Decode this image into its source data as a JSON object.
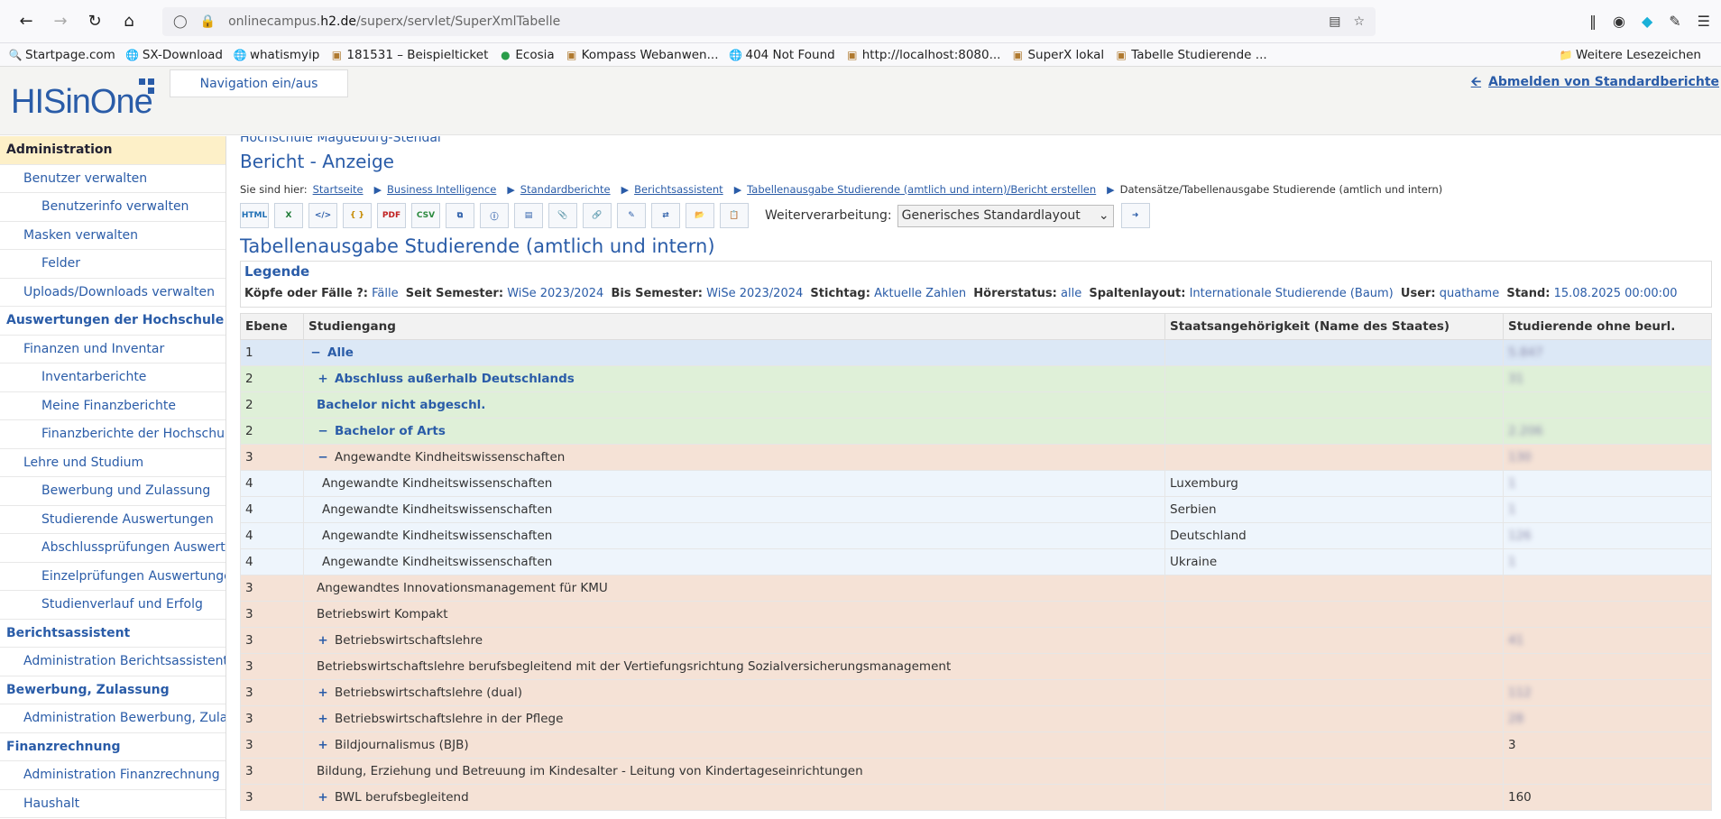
{
  "browser": {
    "url_prefix": "onlinecampus.",
    "url_domain": "h2.de",
    "url_path": "/superx/servlet/SuperXmlTabelle",
    "bookmarks": [
      "Startpage.com",
      "SX-Download",
      "whatismyip",
      "181531 – Beispielticket",
      "Ecosia",
      "Kompass Webanwen...",
      "404 Not Found",
      "http://localhost:8080...",
      "SuperX lokal",
      "Tabelle Studierende ..."
    ],
    "bookmarks_other": "Weitere Lesezeichen"
  },
  "header": {
    "logo": "HISinOne",
    "nav_toggle": "Navigation ein/aus",
    "logout": "Abmelden von Standardberichte"
  },
  "sidebar": [
    {
      "label": "Administration",
      "level": 0,
      "active": true
    },
    {
      "label": "Benutzer verwalten",
      "level": 1
    },
    {
      "label": "Benutzerinfo verwalten",
      "level": 2
    },
    {
      "label": "Masken verwalten",
      "level": 1
    },
    {
      "label": "Felder",
      "level": 2
    },
    {
      "label": "Uploads/Downloads verwalten",
      "level": 1
    },
    {
      "label": "Auswertungen der Hochschule",
      "level": 0
    },
    {
      "label": "Finanzen und Inventar",
      "level": 1
    },
    {
      "label": "Inventarberichte",
      "level": 2
    },
    {
      "label": "Meine Finanzberichte",
      "level": 2
    },
    {
      "label": "Finanzberichte der Hochschule",
      "level": 2
    },
    {
      "label": "Lehre und Studium",
      "level": 1
    },
    {
      "label": "Bewerbung und Zulassung",
      "level": 2
    },
    {
      "label": "Studierende Auswertungen",
      "level": 2
    },
    {
      "label": "Abschlussprüfungen Auswertungen",
      "level": 2
    },
    {
      "label": "Einzelprüfungen Auswertungen",
      "level": 2
    },
    {
      "label": "Studienverlauf und Erfolg",
      "level": 2
    },
    {
      "label": "Berichtsassistent",
      "level": 0
    },
    {
      "label": "Administration Berichtsassistent",
      "level": 1
    },
    {
      "label": "Bewerbung, Zulassung",
      "level": 0
    },
    {
      "label": "Administration Bewerbung, Zulassung",
      "level": 1
    },
    {
      "label": "Finanzrechnung",
      "level": 0
    },
    {
      "label": "Administration Finanzrechnung",
      "level": 1
    },
    {
      "label": "Haushalt",
      "level": 1
    }
  ],
  "main": {
    "hochschule": "Hochschule Magdeburg-Stendal",
    "report_title": "Bericht - Anzeige",
    "breadcrumb_prefix": "Sie sind hier:",
    "breadcrumb": [
      "Startseite",
      "Business Intelligence",
      "Standardberichte",
      "Berichtsassistent",
      "Tabellenausgabe Studierende (amtlich und intern)/Bericht erstellen"
    ],
    "breadcrumb_current": "Datensätze/Tabellenausgabe Studierende (amtlich und intern)",
    "toolbar_icons": [
      "html-export-icon",
      "excel-export-icon",
      "xml-export-icon",
      "json-export-icon",
      "pdf-export-icon",
      "csv-export-icon",
      "copy-icon",
      "info-icon",
      "bookmark-icon",
      "attachment-icon",
      "link-icon",
      "notes-icon",
      "compare-icon",
      "folder-icon",
      "clipboard-icon"
    ],
    "weiterverarbeitung_label": "Weiterverarbeitung:",
    "weiterverarbeitung_value": "Generisches Standardlayout",
    "table_title": "Tabellenausgabe Studierende (amtlich und intern)",
    "legend": {
      "heading": "Legende",
      "items": [
        {
          "key": "Köpfe oder Fälle ?:",
          "value": "Fälle"
        },
        {
          "key": "Seit Semester:",
          "value": "WiSe 2023/2024"
        },
        {
          "key": "Bis Semester:",
          "value": "WiSe 2023/2024"
        },
        {
          "key": "Stichtag:",
          "value": "Aktuelle Zahlen"
        },
        {
          "key": "Hörerstatus:",
          "value": "alle"
        },
        {
          "key": "Spaltenlayout:",
          "value": "Internationale Studierende (Baum)"
        },
        {
          "key": "User:",
          "value": "quathame"
        },
        {
          "key": "Stand:",
          "value": "15.08.2025 00:00:00"
        }
      ]
    },
    "columns": [
      "Ebene",
      "Studiengang",
      "Staatsangehörigkeit (Name des Staates)",
      "Studierende ohne beurl."
    ],
    "rows": [
      {
        "ebene": "1",
        "toggle": "−",
        "name": "Alle",
        "staat": "",
        "value": "5.847",
        "blur": true,
        "style": "r1",
        "indent": 0,
        "bold": true
      },
      {
        "ebene": "2",
        "toggle": "+",
        "name": "Abschluss außerhalb Deutschlands",
        "staat": "",
        "value": "31",
        "blur": true,
        "style": "r2",
        "indent": 1,
        "bold": true
      },
      {
        "ebene": "2",
        "toggle": "",
        "name": "Bachelor nicht abgeschl.",
        "staat": "",
        "value": "",
        "blur": false,
        "style": "r2",
        "indent": 1,
        "bold": true
      },
      {
        "ebene": "2",
        "toggle": "−",
        "name": "Bachelor of Arts",
        "staat": "",
        "value": "2.206",
        "blur": true,
        "style": "r2",
        "indent": 1,
        "bold": true
      },
      {
        "ebene": "3",
        "toggle": "−",
        "name": "Angewandte Kindheitswissenschaften",
        "staat": "",
        "value": "130",
        "blur": true,
        "style": "r3",
        "indent": 2,
        "bold": false
      },
      {
        "ebene": "4",
        "toggle": "",
        "name": "Angewandte Kindheitswissenschaften",
        "staat": "Luxemburg",
        "value": "1",
        "blur": true,
        "style": "r4",
        "indent": 3,
        "bold": false
      },
      {
        "ebene": "4",
        "toggle": "",
        "name": "Angewandte Kindheitswissenschaften",
        "staat": "Serbien",
        "value": "1",
        "blur": true,
        "style": "r4",
        "indent": 3,
        "bold": false
      },
      {
        "ebene": "4",
        "toggle": "",
        "name": "Angewandte Kindheitswissenschaften",
        "staat": "Deutschland",
        "value": "126",
        "blur": true,
        "style": "r4",
        "indent": 3,
        "bold": false
      },
      {
        "ebene": "4",
        "toggle": "",
        "name": "Angewandte Kindheitswissenschaften",
        "staat": "Ukraine",
        "value": "1",
        "blur": true,
        "style": "r4",
        "indent": 3,
        "bold": false
      },
      {
        "ebene": "3",
        "toggle": "",
        "name": "Angewandtes Innovationsmanagement für KMU",
        "staat": "",
        "value": "",
        "blur": false,
        "style": "r3",
        "indent": 2,
        "bold": false
      },
      {
        "ebene": "3",
        "toggle": "",
        "name": "Betriebswirt Kompakt",
        "staat": "",
        "value": "",
        "blur": false,
        "style": "r3",
        "indent": 2,
        "bold": false
      },
      {
        "ebene": "3",
        "toggle": "+",
        "name": "Betriebswirtschaftslehre",
        "staat": "",
        "value": "41",
        "blur": true,
        "style": "r3",
        "indent": 2,
        "bold": false
      },
      {
        "ebene": "3",
        "toggle": "",
        "name": "Betriebswirtschaftslehre berufsbegleitend mit der Vertiefungsrichtung Sozialversicherungsmanagement",
        "staat": "",
        "value": "",
        "blur": false,
        "style": "r3",
        "indent": 2,
        "bold": false
      },
      {
        "ebene": "3",
        "toggle": "+",
        "name": "Betriebswirtschaftslehre (dual)",
        "staat": "",
        "value": "112",
        "blur": true,
        "style": "r3",
        "indent": 2,
        "bold": false
      },
      {
        "ebene": "3",
        "toggle": "+",
        "name": "Betriebswirtschaftslehre in der Pflege",
        "staat": "",
        "value": "28",
        "blur": true,
        "style": "r3",
        "indent": 2,
        "bold": false
      },
      {
        "ebene": "3",
        "toggle": "+",
        "name": "Bildjournalismus (BJB)",
        "staat": "",
        "value": "3",
        "blur": false,
        "style": "r3",
        "indent": 2,
        "bold": false
      },
      {
        "ebene": "3",
        "toggle": "",
        "name": "Bildung, Erziehung und Betreuung im Kindesalter - Leitung von Kindertageseinrichtungen",
        "staat": "",
        "value": "",
        "blur": false,
        "style": "r3",
        "indent": 2,
        "bold": false
      },
      {
        "ebene": "3",
        "toggle": "+",
        "name": "BWL berufsbegleitend",
        "staat": "",
        "value": "160",
        "blur": false,
        "style": "r3",
        "indent": 2,
        "bold": false
      }
    ]
  }
}
